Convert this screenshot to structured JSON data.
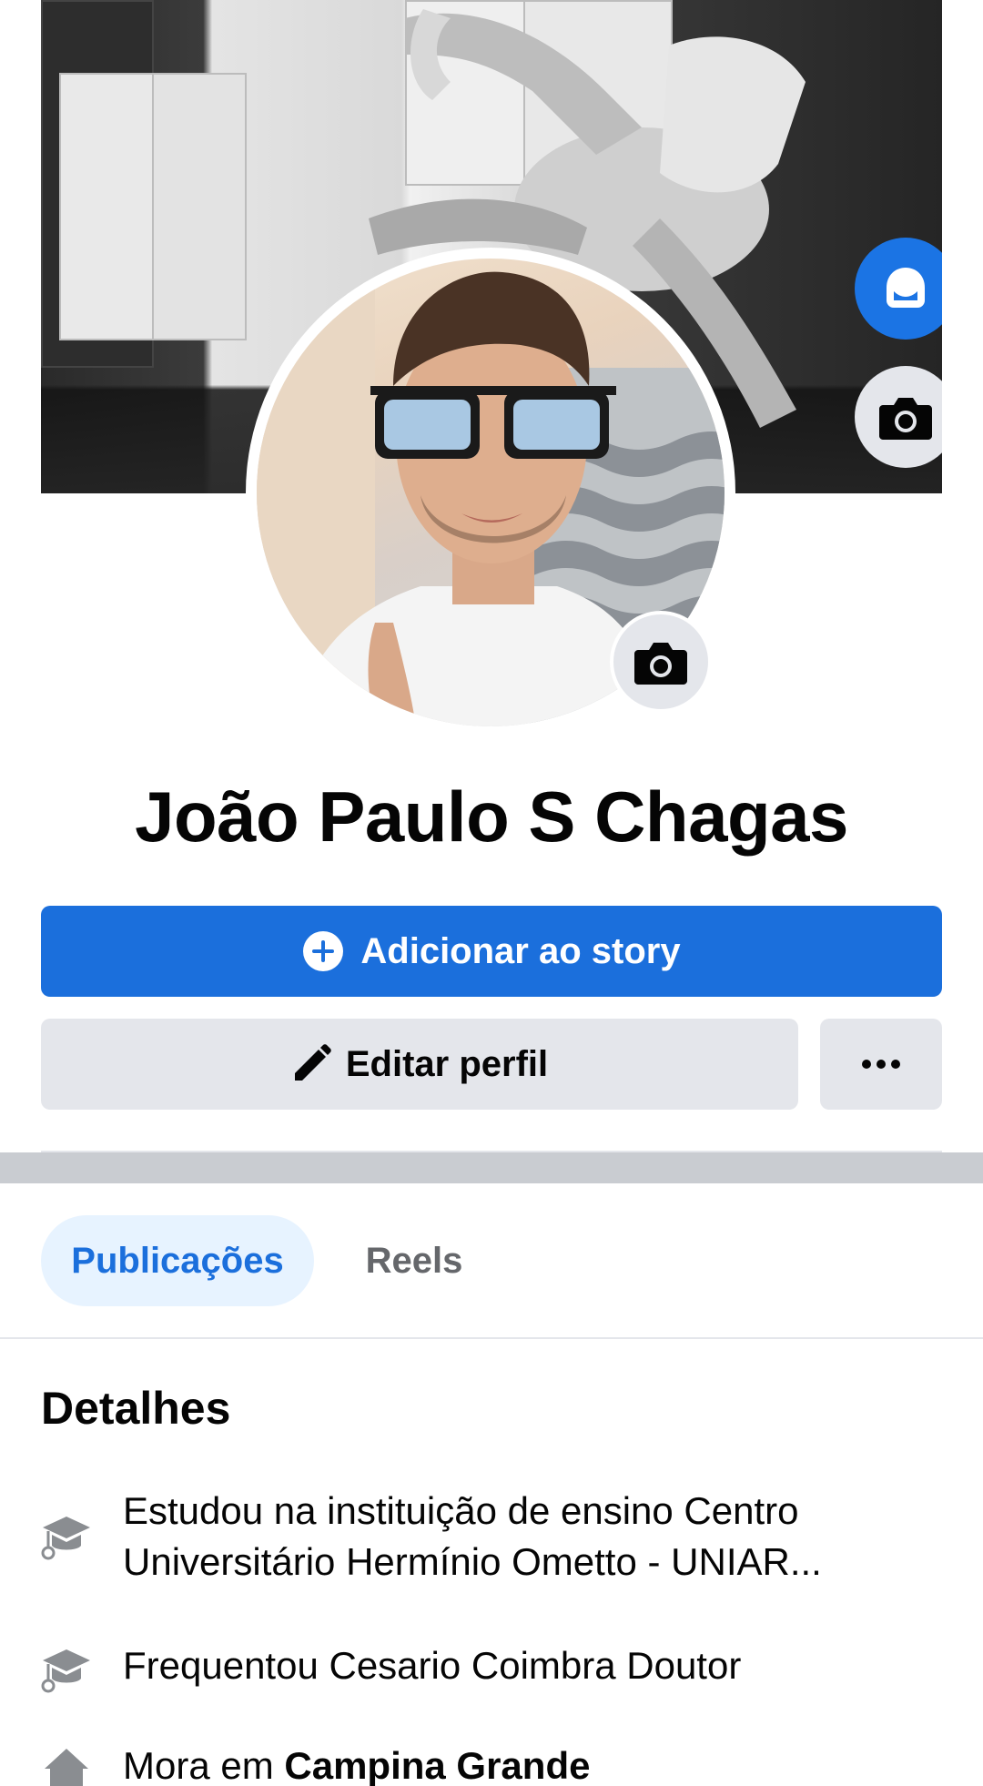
{
  "profile": {
    "name": "João Paulo S Chagas"
  },
  "actions": {
    "add_story_label": "Adicionar ao story",
    "edit_profile_label": "Editar perfil",
    "more_label": "..."
  },
  "tabs": [
    {
      "label": "Publicações",
      "selected": true
    },
    {
      "label": "Reels",
      "selected": false
    }
  ],
  "details": {
    "title": "Detalhes",
    "items": [
      {
        "icon": "graduation-cap-icon",
        "text": "Estudou na instituição de ensino Centro Universitário Hermínio Ometto - UNIAR..."
      },
      {
        "icon": "graduation-cap-icon",
        "text": "Frequentou Cesario Coimbra Doutor"
      },
      {
        "icon": "home-icon",
        "prefix": "Mora em ",
        "bold": "Campina Grande"
      }
    ]
  },
  "colors": {
    "primary": "#1b6fdc",
    "secondary_button": "#e4e6eb",
    "tab_selected_bg": "#e7f3ff",
    "divider": "#c9ccd1",
    "muted_text": "#65676b"
  }
}
